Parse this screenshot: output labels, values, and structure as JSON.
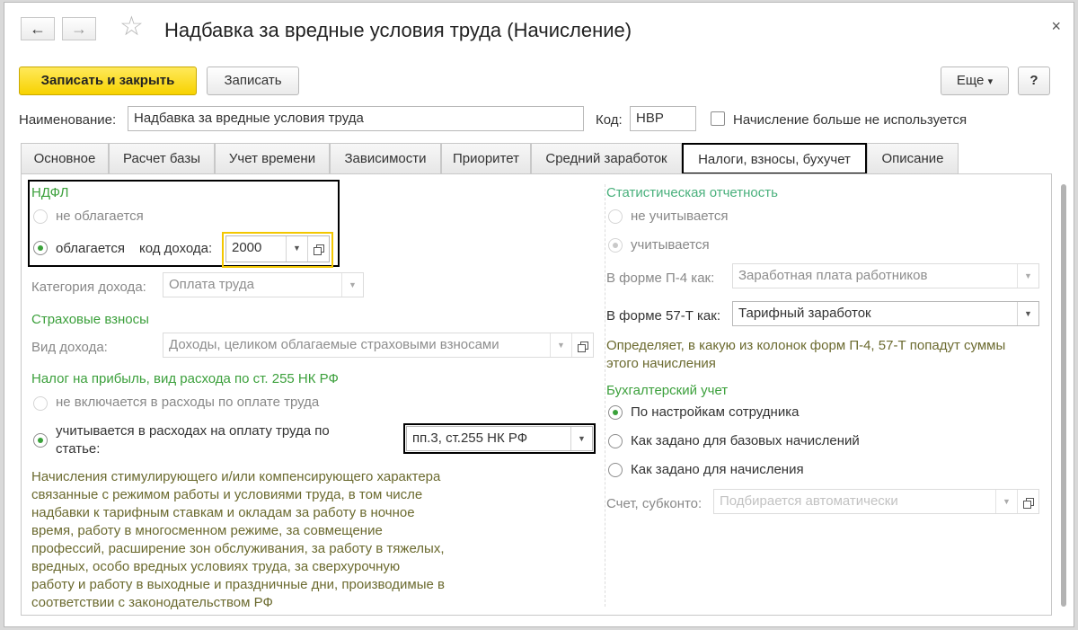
{
  "window": {
    "title": "Надбавка за вредные условия труда (Начисление)",
    "back_icon": "←",
    "forward_icon": "→",
    "star_icon": "☆",
    "close_icon": "×"
  },
  "toolbar": {
    "save_close_label": "Записать и закрыть",
    "save_label": "Записать",
    "more_label": "Еще",
    "more_arrow": "▾",
    "help_label": "?"
  },
  "header": {
    "name_label": "Наименование:",
    "name_value": "Надбавка за вредные условия труда",
    "code_label": "Код:",
    "code_value": "НВР",
    "unused_label": "Начисление больше не используется"
  },
  "tabs": [
    {
      "label": "Основное"
    },
    {
      "label": "Расчет базы"
    },
    {
      "label": "Учет времени"
    },
    {
      "label": "Зависимости"
    },
    {
      "label": "Приоритет"
    },
    {
      "label": "Средний заработок"
    },
    {
      "label": "Налоги, взносы, бухучет"
    },
    {
      "label": "Описание"
    }
  ],
  "ndfl": {
    "title": "НДФЛ",
    "not_taxed_label": "не облагается",
    "taxed_label": "облагается",
    "income_code_label": "код дохода:",
    "income_code_value": "2000",
    "income_category_label": "Категория дохода:",
    "income_category_value": "Оплата труда"
  },
  "insurance": {
    "title": "Страховые взносы",
    "income_type_label": "Вид дохода:",
    "income_type_value": "Доходы, целиком облагаемые страховыми взносами"
  },
  "profit_tax": {
    "title": "Налог на прибыль, вид расхода по ст. 255 НК РФ",
    "not_included_label": "не включается в расходы по оплате труда",
    "included_label_line1": "учитывается в расходах на оплату труда по",
    "included_label_line2": "статье:",
    "article_value": "пп.3, ст.255 НК РФ",
    "description": [
      "Начисления стимулирующего и/или компенсирующего характера",
      "связанные с режимом работы и условиями труда, в том числе",
      "надбавки к тарифным ставкам и окладам за работу в ночное",
      "время, работу в многосменном режиме, за совмещение",
      "профессий, расширение зон обслуживания, за работу в тяжелых,",
      "вредных, особо вредных условиях труда, за сверхурочную",
      "работу и работу в выходные и праздничные дни, производимые в",
      "соответствии с законодательством РФ"
    ]
  },
  "stats": {
    "title": "Статистическая отчетность",
    "not_counted_label": "не учитывается",
    "counted_label": "учитывается",
    "p4_label": "В форме П-4 как:",
    "p4_value": "Заработная плата работников",
    "f57_label": "В форме 57-Т как:",
    "f57_value": "Тарифный заработок",
    "note_line1": "Определяет, в какую из колонок форм П-4, 57-Т попадут суммы",
    "note_line2": "этого начисления"
  },
  "accounting": {
    "title": "Бухгалтерский учет",
    "option1": "По настройкам сотрудника",
    "option2": "Как задано для базовых начислений",
    "option3": "Как задано для начисления",
    "account_label": "Счет, субконто:",
    "account_placeholder": "Подбирается автоматически"
  },
  "colors": {
    "primary_button": "#f7d200",
    "section_green": "#3ca03c",
    "description_olive": "#6b6a2f",
    "highlight_yellow": "#f3c700"
  }
}
